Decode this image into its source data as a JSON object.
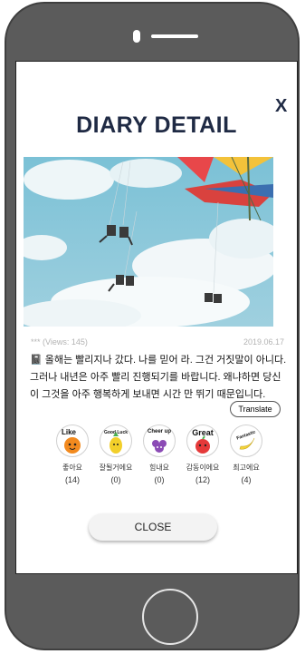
{
  "modal": {
    "close_x": "X",
    "title": "DIARY DETAIL",
    "views": "*** (Views: 145)",
    "date": "2019.06.17",
    "text": "📓 올해는 빨리지나 갔다. 나를 믿어 라. 그건 거짓말이 아니다. 그러나 내년은 아주 빨리 진행되기를 바랍니다. 왜냐하면 당신이 그것을 아주 행복하게 보내면 시간 만 뛰기 때문입니다.",
    "translate_label": "Translate",
    "close_label": "CLOSE"
  },
  "reactions": [
    {
      "badge": "Like",
      "label": "좋아요",
      "count": "(14)",
      "color": "#f28a1f",
      "icon": "orange-icon"
    },
    {
      "badge": "Good Luck",
      "label": "잘될거에요",
      "count": "(0)",
      "color": "#f2cf2a",
      "icon": "pineapple-icon"
    },
    {
      "badge": "Cheer up",
      "label": "힘내요",
      "count": "(0)",
      "color": "#8b4bb5",
      "icon": "grape-icon"
    },
    {
      "badge": "Great",
      "label": "감동이에요",
      "count": "(12)",
      "color": "#e53a3a",
      "icon": "apple-icon"
    },
    {
      "badge": "Fantastic",
      "label": "최고에요",
      "count": "(4)",
      "color": "#f4d43a",
      "icon": "banana-icon"
    }
  ]
}
